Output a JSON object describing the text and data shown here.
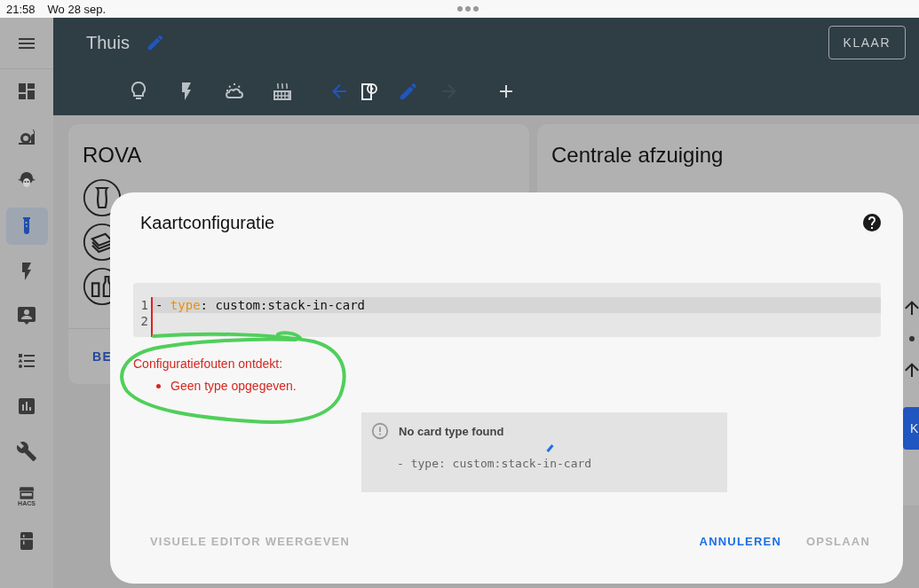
{
  "status_bar": {
    "time": "21:58",
    "date": "Wo 28 sep."
  },
  "sidebar": {
    "items": [
      {
        "selected": false
      },
      {
        "selected": false
      },
      {
        "selected": false
      },
      {
        "selected": true
      },
      {
        "selected": false
      },
      {
        "selected": false
      },
      {
        "selected": false
      },
      {
        "selected": false
      },
      {
        "selected": false
      },
      {
        "selected": false,
        "badge": "HACS"
      },
      {
        "selected": false
      }
    ]
  },
  "header": {
    "title": "Thuis",
    "done_button": "KLAAR",
    "views": [
      {
        "selected": false
      },
      {
        "selected": false
      },
      {
        "selected": false
      },
      {
        "selected": false
      },
      {
        "selected": true
      }
    ]
  },
  "cards": [
    {
      "title": "ROVA",
      "footer_link": "BE"
    },
    {
      "title": "Centrale afzuiging",
      "side_button": "K"
    }
  ],
  "dialog": {
    "title": "Kaartconfiguratie",
    "editor": {
      "lines": [
        {
          "number": "1",
          "active": true,
          "segments": [
            {
              "kind": "plain",
              "text": "- "
            },
            {
              "kind": "key",
              "text": "type"
            },
            {
              "kind": "plain",
              "text": ": custom:stack-in-card"
            }
          ]
        },
        {
          "number": "2",
          "active": false
        }
      ]
    },
    "error": {
      "heading": "Configuratiefouten ontdekt:",
      "items": [
        "Geen type opgegeven."
      ]
    },
    "preview": {
      "title": "No card type found",
      "code": "- type: custom:stack-in-card"
    },
    "buttons": [
      {
        "label": "VISUELE EDITOR WEERGEVEN",
        "kind": "left",
        "disabled": true
      },
      {
        "label": "ANNULEREN",
        "kind": "right",
        "disabled": false
      },
      {
        "label": "OPSLAAN",
        "kind": "right",
        "disabled": true
      }
    ]
  }
}
